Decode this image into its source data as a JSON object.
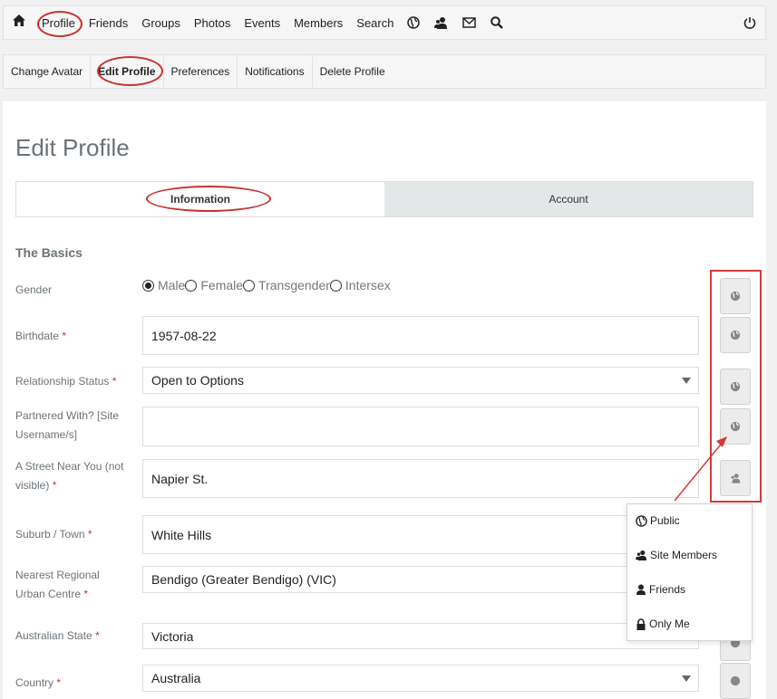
{
  "top_nav": {
    "items": [
      "Profile",
      "Friends",
      "Groups",
      "Photos",
      "Events",
      "Members",
      "Search"
    ],
    "icons": [
      "home-icon",
      "globe-icon",
      "members-icon",
      "mail-icon",
      "search-icon",
      "power-icon"
    ]
  },
  "sub_nav": {
    "items": [
      "Change Avatar",
      "Edit Profile",
      "Preferences",
      "Notifications",
      "Delete Profile"
    ],
    "active": "Edit Profile"
  },
  "page": {
    "title": "Edit Profile",
    "tabs": [
      "Information",
      "Account"
    ],
    "section_title": "The Basics"
  },
  "form": {
    "gender_label": "Gender",
    "gender_options": [
      "Male",
      "Female",
      "Transgender",
      "Intersex"
    ],
    "gender_selected": "Male",
    "birthdate_label": "Birthdate",
    "birthdate_value": "1957-08-22",
    "relationship_label": "Relationship Status",
    "relationship_value": "Open to Options",
    "partnered_label": "Partnered With? [Site Username/s]",
    "partnered_value": "",
    "street_label": "A Street Near You (not visible)",
    "street_value": "Napier St.",
    "suburb_label": "Suburb / Town",
    "suburb_value": "White Hills",
    "regional_label": "Nearest Regional Urban Centre",
    "regional_value": "Bendigo (Greater Bendigo) (VIC)",
    "state_label": "Australian State",
    "state_value": "Victoria",
    "country_label": "Country",
    "country_value": "Australia",
    "required_mark": "*"
  },
  "privacy_menu": {
    "options": [
      "Public",
      "Site Members",
      "Friends",
      "Only Me"
    ]
  },
  "colors": {
    "annotation_red": "#d23a3a",
    "tab_inactive_bg": "#e3e7e8",
    "label_gray": "#6b7378"
  }
}
